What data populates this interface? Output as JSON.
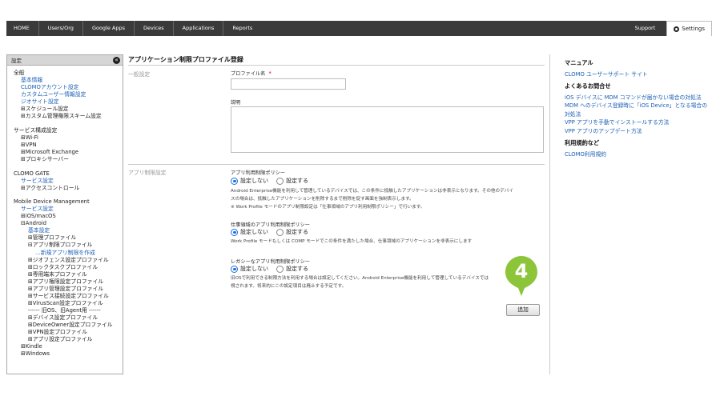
{
  "topnav": {
    "items": [
      "HOME",
      "Users/Org",
      "Google Apps",
      "Devices",
      "Applications",
      "Reports"
    ],
    "support": "Support",
    "settings": "Settings"
  },
  "sidebar": {
    "header": "設定",
    "collapse_icon": "«",
    "rows": [
      {
        "text": "全般",
        "indent": 0,
        "link": false
      },
      {
        "text": "基本情報",
        "indent": 1,
        "link": true
      },
      {
        "text": "CLOMOアカウント設定",
        "indent": 1,
        "link": true
      },
      {
        "text": "カスタムユーザー情報設定",
        "indent": 1,
        "link": true
      },
      {
        "text": "ジオサイト設定",
        "indent": 1,
        "link": true
      },
      {
        "text": "⊞スケジュール設定",
        "indent": 1,
        "link": false
      },
      {
        "text": "⊞カスタム管理権限スキーム設定",
        "indent": 1,
        "link": false
      },
      {
        "gap": true
      },
      {
        "text": "サービス構成設定",
        "indent": 0,
        "link": false
      },
      {
        "text": "⊞Wi-Fi",
        "indent": 1,
        "link": false
      },
      {
        "text": "⊞VPN",
        "indent": 1,
        "link": false
      },
      {
        "text": "⊞Microsoft Exchange",
        "indent": 1,
        "link": false
      },
      {
        "text": "⊞プロキシサーバー",
        "indent": 1,
        "link": false
      },
      {
        "gap": true
      },
      {
        "text": "CLOMO GATE",
        "indent": 0,
        "link": false
      },
      {
        "text": "サービス設定",
        "indent": 1,
        "link": true
      },
      {
        "text": "⊞アクセスコントロール",
        "indent": 1,
        "link": false
      },
      {
        "gap": true
      },
      {
        "text": "Mobile Device Management",
        "indent": 0,
        "link": false
      },
      {
        "text": "サービス設定",
        "indent": 1,
        "link": true
      },
      {
        "text": "⊞iOS/macOS",
        "indent": 1,
        "link": false
      },
      {
        "text": "⊟Android",
        "indent": 1,
        "link": false
      },
      {
        "text": "基本設定",
        "indent": 2,
        "link": true
      },
      {
        "text": "⊞管理プロファイル",
        "indent": 2,
        "link": false
      },
      {
        "text": "⊟アプリ制限プロファイル",
        "indent": 2,
        "link": false
      },
      {
        "text": "…新規アプリ制限を作成",
        "indent": 3,
        "link": true
      },
      {
        "text": "⊞ジオフェンス設定プロファイル",
        "indent": 2,
        "link": false
      },
      {
        "text": "⊞ロックタスクプロファイル",
        "indent": 2,
        "link": false
      },
      {
        "text": "⊞専用端末プロファイル",
        "indent": 2,
        "link": false
      },
      {
        "text": "⊞アプリ権限設定プロファイル",
        "indent": 2,
        "link": false
      },
      {
        "text": "⊞アプリ管理設定プロファイル",
        "indent": 2,
        "link": false
      },
      {
        "text": "⊞サービス接続設定プロファイル",
        "indent": 2,
        "link": false
      },
      {
        "text": "⊞VirusScan設定プロファイル",
        "indent": 2,
        "link": false
      },
      {
        "text": "------ 旧OS、旧Agent用 ------",
        "indent": 2,
        "link": false
      },
      {
        "text": "⊞デバイス設定プロファイル",
        "indent": 2,
        "link": false
      },
      {
        "text": "⊞DeviceOwner設定プロファイル",
        "indent": 2,
        "link": false
      },
      {
        "text": "⊞VPN設定プロファイル",
        "indent": 2,
        "link": false
      },
      {
        "text": "⊞アプリ設定プロファイル",
        "indent": 2,
        "link": false
      },
      {
        "text": "⊞Kindle",
        "indent": 1,
        "link": false
      },
      {
        "text": "⊞Windows",
        "indent": 1,
        "link": false
      }
    ]
  },
  "main": {
    "title": "アプリケーション制限プロファイル登録",
    "general_label": "一般設定",
    "profile_name_label": "プロファイル名",
    "required_mark": "*",
    "description_label": "説明",
    "app_restriction_label": "アプリ制限設定",
    "policies": [
      {
        "title": "アプリ利用制限ポリシー",
        "options": [
          "設定しない",
          "設定する"
        ],
        "selected": 0,
        "desc": [
          "Android Enterprise機能を利用して管理しているデバイスでは、この条件に抵触したアプリケーションは非表示となります。その他のデバイ",
          "スの場合は、抵触したアプリケーションを削除するまで削除を促す画面を強制表示します。",
          "※ Work Profile モードのアプリ制限設定は「仕事領域のアプリ利用制限ポリシー」で行います。"
        ]
      },
      {
        "title": "仕事領域のアプリ利用制限ポリシー",
        "options": [
          "設定しない",
          "設定する"
        ],
        "selected": 0,
        "desc": [
          "Work Profile モードもしくは COMP モードでこの条件を満たした場合、仕事領域のアプリケーションを非表示にします"
        ]
      },
      {
        "title": "レガシーなアプリ利用制限ポリシー",
        "options": [
          "設定しない",
          "設定する"
        ],
        "selected": 0,
        "desc": [
          "旧OSで利用できる制限方法を利用する場合は設定してください。Android Enterprise機能を利用して管理しているデバイスでは",
          "視されます。将来的にこの設定項目は廃止する予定です。"
        ]
      }
    ],
    "add_button": "追加",
    "step_number": "4",
    "badge_color": "#8cc43a"
  },
  "right": {
    "manual_head": "マニュアル",
    "manual_links": [
      "CLOMO ユーザーサポート サイト"
    ],
    "faq_head": "よくあるお問合せ",
    "faq_links": [
      "iOS デバイスに MDM コマンドが届かない場合の対処法",
      "MDM へのデバイス登録時に「iOS Device」となる場合の対処法",
      "VPP アプリを手動でインストールする方法",
      "VPP アプリのアップデート方法"
    ],
    "terms_head": "利用規約など",
    "terms_links": [
      "CLOMO利用規約"
    ]
  }
}
